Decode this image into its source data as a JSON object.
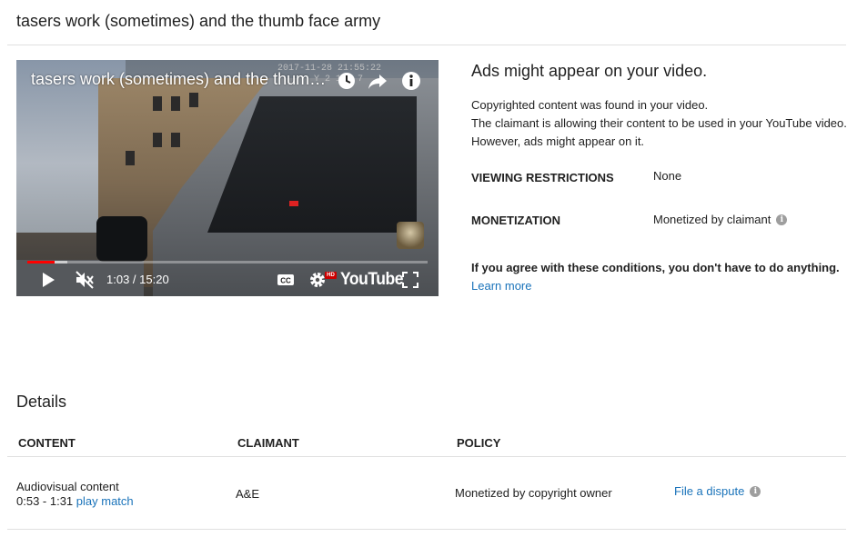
{
  "page": {
    "title": "tasers work (sometimes) and the thumb face army"
  },
  "player": {
    "video_title": "tasers work (sometimes) and the thum…",
    "timestamp_line1": "2017-11-28 21:55:22",
    "timestamp_line2": "Y 2    104      7",
    "current_time": "1:03",
    "duration": "15:20",
    "time_display": "1:03 / 15:20",
    "progress_played_fraction": 0.068,
    "progress_loaded_fraction": 0.1,
    "hd_badge": "HD",
    "logo_text": "YouTube",
    "icons": {
      "watch_later": "clock-icon",
      "share": "share-icon",
      "info": "info-icon",
      "play": "play-icon",
      "mute": "volume-muted-icon",
      "captions": "cc-icon",
      "settings": "gear-icon",
      "fullscreen": "fullscreen-icon"
    }
  },
  "info": {
    "heading": "Ads might appear on your video.",
    "line1": "Copyrighted content was found in your video.",
    "line2": "The claimant is allowing their content to be used in your YouTube video.",
    "line3": "However, ads might appear on it.",
    "viewing_restrictions_label": "VIEWING RESTRICTIONS",
    "viewing_restrictions_value": "None",
    "monetization_label": "MONETIZATION",
    "monetization_value": "Monetized by claimant",
    "agree_text": "If you agree with these conditions, you don't have to do anything.",
    "learn_more": "Learn more"
  },
  "details": {
    "heading": "Details",
    "columns": [
      "CONTENT",
      "CLAIMANT",
      "POLICY"
    ],
    "rows": [
      {
        "content_type": "Audiovisual content",
        "range": "0:53 - 1:31",
        "play_match": "play match",
        "claimant": "A&E",
        "policy": "Monetized by copyright owner",
        "action": "File a dispute"
      }
    ]
  },
  "colors": {
    "link": "#1a73ba",
    "progress": "#ff0000",
    "divider": "#e0e0e0"
  }
}
